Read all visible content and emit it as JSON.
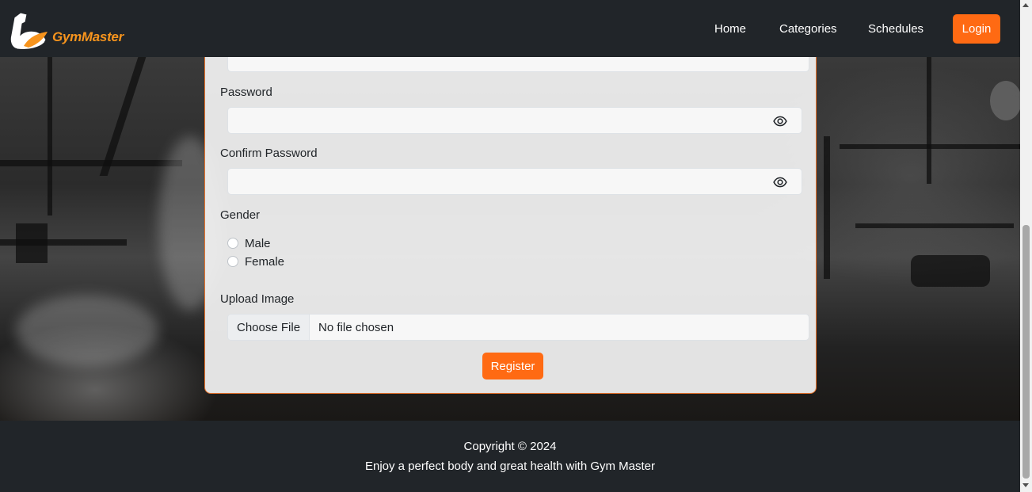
{
  "brand": {
    "name": "GymMaster"
  },
  "nav": {
    "links": [
      "Home",
      "Categories",
      "Schedules"
    ],
    "login_label": "Login"
  },
  "form": {
    "password_label": "Password",
    "confirm_password_label": "Confirm Password",
    "gender_label": "Gender",
    "gender_options": [
      "Male",
      "Female"
    ],
    "upload_label": "Upload Image",
    "file_button_label": "Choose File",
    "file_status": "No file chosen",
    "register_label": "Register"
  },
  "footer": {
    "copyright": "Copyright © 2024",
    "tagline": "Enjoy a perfect body and great health with Gym Master"
  },
  "colors": {
    "accent": "#ff6a13",
    "navbar": "#212529",
    "logo": "#f7941d"
  }
}
